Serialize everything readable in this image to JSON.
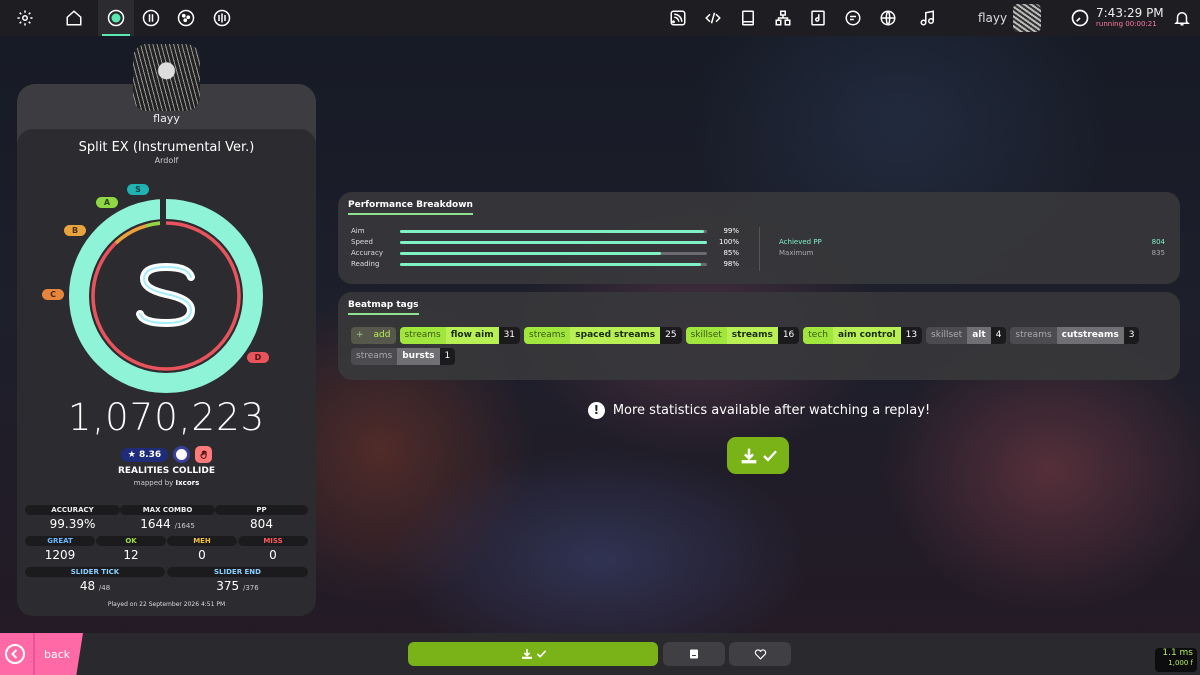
{
  "topbar": {
    "user_name": "flayy",
    "clock_time": "7:43:29 PM",
    "clock_running": "running 00:00:21"
  },
  "player": {
    "name": "flayy"
  },
  "beatmap": {
    "title": "Split EX (Instrumental Ver.)",
    "artist": "Ardolf",
    "difficulty": "REALITIES COLLIDE",
    "mapped_by_prefix": "mapped by",
    "mapper": "Ixcors",
    "star_rating": "★ 8.36"
  },
  "score": {
    "rank": "S",
    "total": "1,070,223",
    "rank_letters": [
      "S",
      "A",
      "B",
      "C",
      "D"
    ],
    "accuracy_fraction": 0.9939,
    "played_on": "Played on 22 September 2026 4:51 PM"
  },
  "stats": {
    "accuracy": {
      "label": "ACCURACY",
      "value": "99.39%"
    },
    "max_combo": {
      "label": "MAX COMBO",
      "value": "1644",
      "max": "/1645"
    },
    "pp": {
      "label": "PP",
      "value": "804"
    },
    "great": {
      "label": "GREAT",
      "value": "1209"
    },
    "ok": {
      "label": "OK",
      "value": "12"
    },
    "meh": {
      "label": "MEH",
      "value": "0"
    },
    "miss": {
      "label": "MISS",
      "value": "0"
    },
    "slider_tick": {
      "label": "SLIDER TICK",
      "value": "48",
      "max": "/48"
    },
    "slider_end": {
      "label": "SLIDER END",
      "value": "375",
      "max": "/376"
    }
  },
  "performance": {
    "title": "Performance Breakdown",
    "rows": [
      {
        "label": "Aim",
        "percent": "99%",
        "fill": 0.99
      },
      {
        "label": "Speed",
        "percent": "100%",
        "fill": 1.0
      },
      {
        "label": "Accuracy",
        "percent": "85%",
        "fill": 0.85
      },
      {
        "label": "Reading",
        "percent": "98%",
        "fill": 0.98
      }
    ],
    "achieved_label": "Achieved PP",
    "achieved_value": "804",
    "maximum_label": "Maximum",
    "maximum_value": "835"
  },
  "tags": {
    "title": "Beatmap tags",
    "add_plus": "+",
    "add_label": "add",
    "items": [
      {
        "category": "streams",
        "name": "flow aim",
        "count": "31",
        "style": "green"
      },
      {
        "category": "streams",
        "name": "spaced streams",
        "count": "25",
        "style": "green"
      },
      {
        "category": "skillset",
        "name": "streams",
        "count": "16",
        "style": "green"
      },
      {
        "category": "tech",
        "name": "aim control",
        "count": "13",
        "style": "green"
      },
      {
        "category": "skillset",
        "name": "alt",
        "count": "4",
        "style": "grey"
      },
      {
        "category": "streams",
        "name": "cutstreams",
        "count": "3",
        "style": "grey"
      },
      {
        "category": "streams",
        "name": "bursts",
        "count": "1",
        "style": "grey"
      }
    ]
  },
  "notice": {
    "icon": "!",
    "text": "More statistics available after watching a replay!"
  },
  "bottombar": {
    "back_label": "back",
    "frame_ms": "1.1 ms",
    "fps": "1,000 f"
  },
  "colors": {
    "accent_green": "#b8f055",
    "mint": "#7ef2c4",
    "back_pink": "#ff6aa6"
  }
}
